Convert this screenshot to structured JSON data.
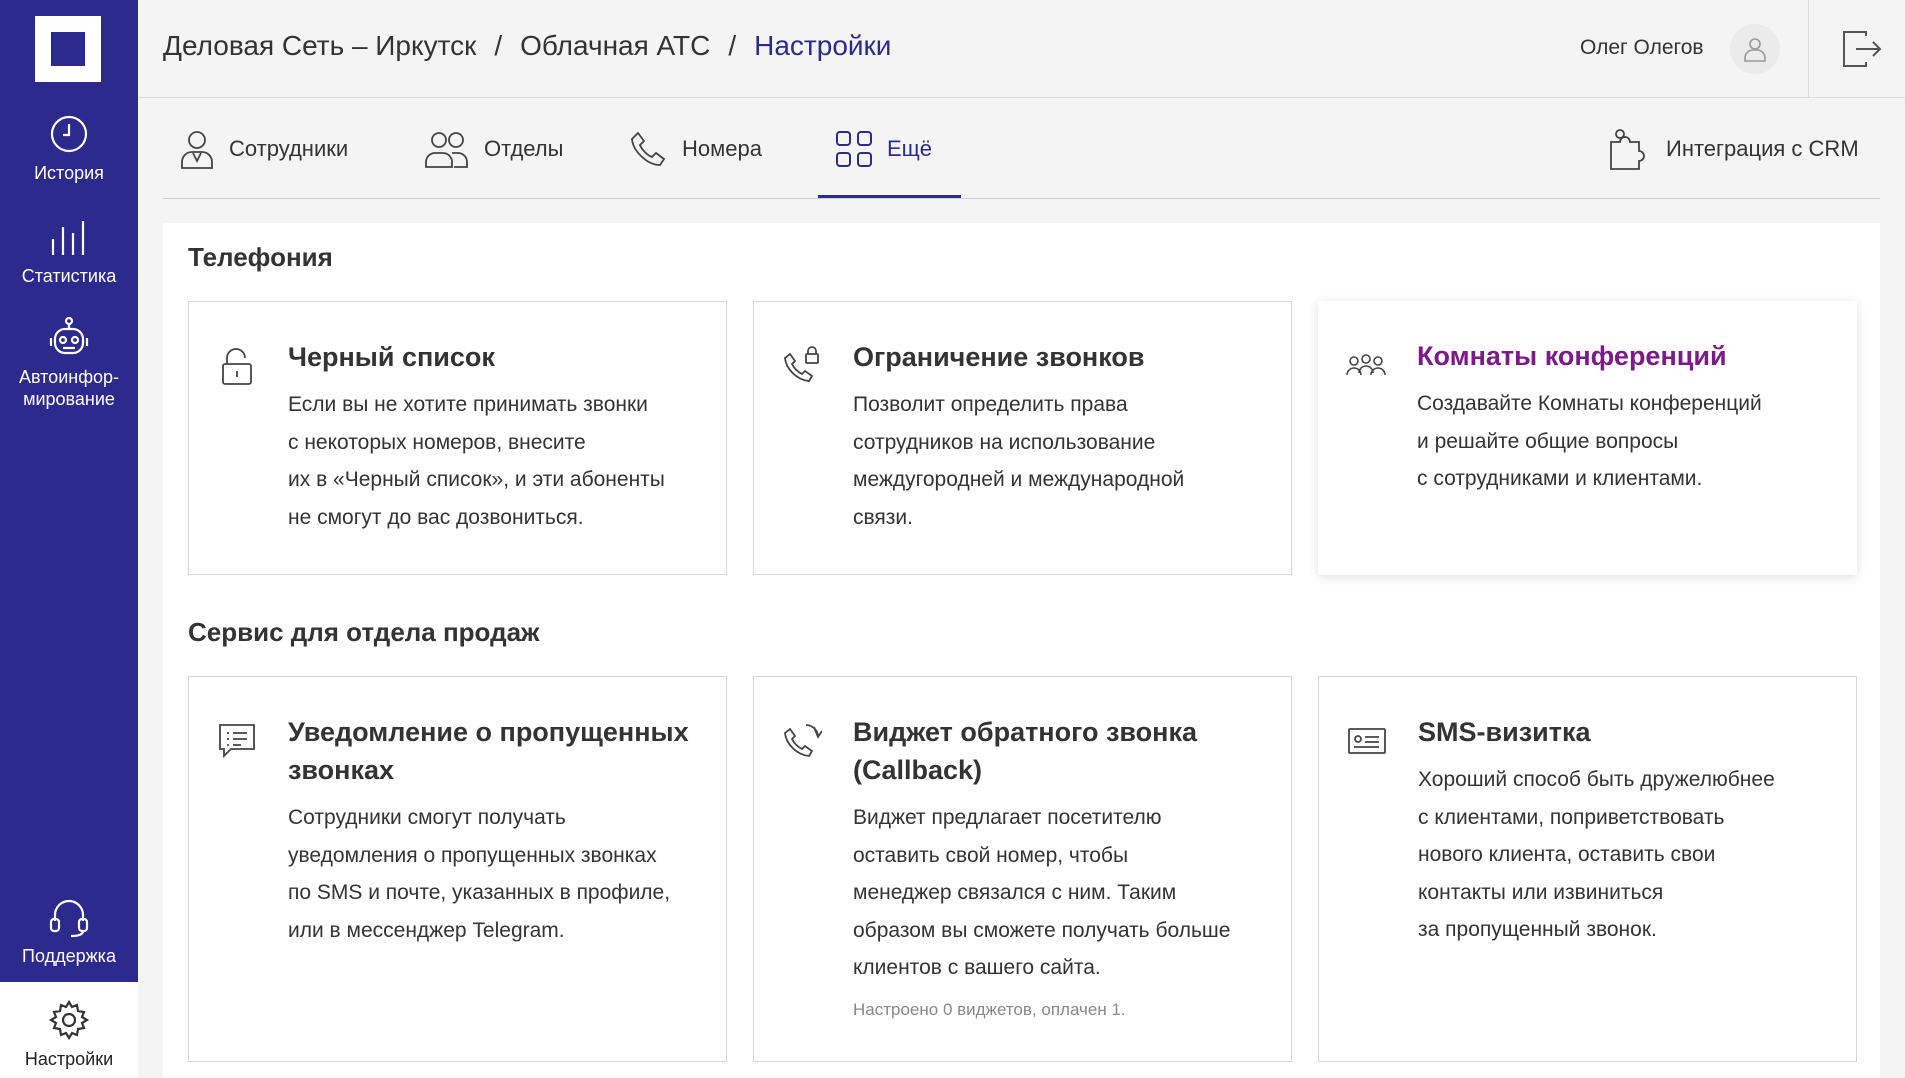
{
  "sidebar": {
    "items": [
      {
        "label": "История",
        "icon": "clock-icon"
      },
      {
        "label": "Статистика",
        "icon": "bar-chart-icon"
      },
      {
        "label": "Автоинфор-мирование",
        "label_line1": "Автоинфор-",
        "label_line2": "мирование",
        "icon": "robot-icon"
      },
      {
        "label": "Поддержка",
        "icon": "headset-icon"
      },
      {
        "label": "Настройки",
        "icon": "gear-icon"
      }
    ]
  },
  "header": {
    "breadcrumb": [
      "Деловая Сеть – Иркутск",
      "Облачная АТС",
      "Настройки"
    ],
    "separator": "/",
    "user_name": "Олег Олегов"
  },
  "tabs": [
    {
      "label": "Сотрудники",
      "icon": "person-icon",
      "active": false
    },
    {
      "label": "Отделы",
      "icon": "group-icon",
      "active": false
    },
    {
      "label": "Номера",
      "icon": "phone-icon",
      "active": false
    },
    {
      "label": "Ещё",
      "icon": "grid-icon",
      "active": true
    },
    {
      "label": "Интеграция с CRM",
      "icon": "puzzle-icon",
      "active": false
    }
  ],
  "sections": [
    {
      "title": "Телефония",
      "cards": [
        {
          "title": "Черный список",
          "text": "Если вы не хотите принимать звонки с некоторых номеров, внесите их в «Черный список», и эти абоненты не смогут до вас дозвониться.",
          "lines": [
            "Если вы не хотите принимать звонки",
            "с некоторых номеров, внесите",
            "их в «Черный список», и эти абоненты",
            "не смогут до вас дозвониться."
          ],
          "icon": "lock-icon"
        },
        {
          "title": "Ограничение звонков",
          "lines": [
            "Позволит определить права",
            "сотрудников на использование",
            "междугородней и международной",
            "связи."
          ],
          "icon": "phone-lock-icon"
        },
        {
          "title": "Комнаты конференций",
          "lines": [
            "Создавайте Комнаты конференций",
            "и решайте общие вопросы",
            "с сотрудниками и клиентами."
          ],
          "icon": "conference-icon"
        }
      ]
    },
    {
      "title": "Сервис для отдела продаж",
      "cards": [
        {
          "title": "Уведомление о пропущенных звонках",
          "lines": [
            "Сотрудники смогут получать",
            "уведомления о пропущенных звонках",
            "по SMS и почте, указанных в профиле,",
            "или в мессенджер Telegram."
          ],
          "icon": "message-icon"
        },
        {
          "title": "Виджет обратного звонка (Callback)",
          "lines": [
            "Виджет предлагает посетителю",
            "оставить свой номер, чтобы",
            "менеджер связался с ним. Таким",
            "образом вы сможете получать больше",
            "клиентов с вашего сайта."
          ],
          "note": "Настроено 0 виджетов, оплачен 1.",
          "icon": "callback-icon"
        },
        {
          "title": "SMS-визитка",
          "lines": [
            "Хороший способ быть дружелюбнее",
            "с клиентами, поприветствовать",
            "нового клиента, оставить свои",
            "контакты или извиниться",
            "за пропущенный звонок."
          ],
          "icon": "card-icon"
        }
      ]
    }
  ]
}
